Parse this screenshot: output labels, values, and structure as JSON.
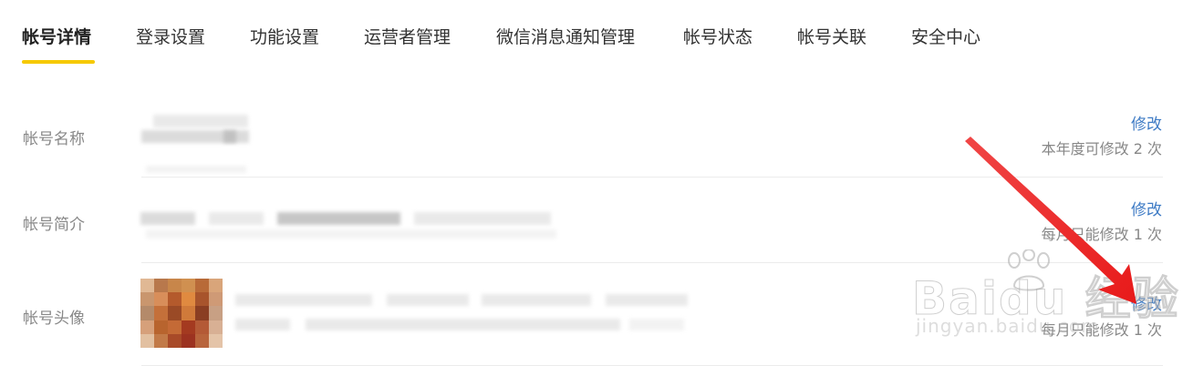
{
  "tabs": [
    {
      "label": "帐号详情",
      "active": true
    },
    {
      "label": "登录设置",
      "active": false
    },
    {
      "label": "功能设置",
      "active": false
    },
    {
      "label": "运营者管理",
      "active": false
    },
    {
      "label": "微信消息通知管理",
      "active": false
    },
    {
      "label": "帐号状态",
      "active": false
    },
    {
      "label": "帐号关联",
      "active": false
    },
    {
      "label": "安全中心",
      "active": false
    }
  ],
  "accent_color": "#f6c900",
  "link_color": "#3e7bc5",
  "rows": [
    {
      "label": "帐号名称",
      "action": "修改",
      "note": "本年度可修改 2 次"
    },
    {
      "label": "帐号简介",
      "action": "修改",
      "note": "每月只能修改 1 次"
    },
    {
      "label": "帐号头像",
      "action": "修改",
      "note": "每月只能修改 1 次"
    }
  ],
  "watermark": {
    "main": "Baidu 经验",
    "sub": "jingyan.baidu.com"
  }
}
